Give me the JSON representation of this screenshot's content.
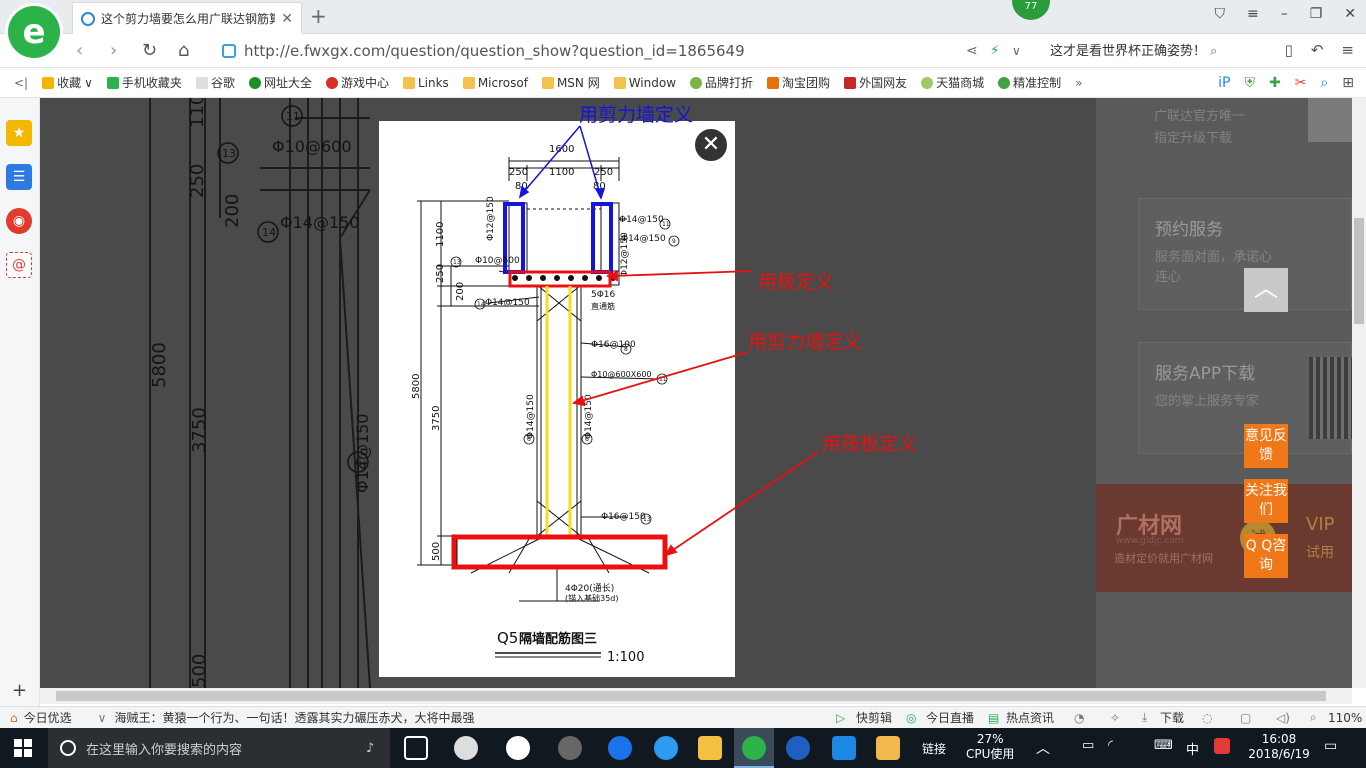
{
  "browser": {
    "tab_title": "这个剪力墙要怎么用广联达钢筋算",
    "badge": "77",
    "url": "http://e.fwxgx.com/question/question_show?question_id=1865649",
    "search_hint": "这才是看世界杯正确姿势！",
    "bookmarks": [
      "收藏",
      "手机收藏夹",
      "谷歌",
      "网址大全",
      "游戏中心",
      "Links",
      "Microsof",
      "MSN 网",
      "Window",
      "品牌打折",
      "淘宝团购",
      "外国网友",
      "天猫商城",
      "精准控制"
    ],
    "bookmark_colors": [
      "#f4b400",
      "#2bb34a",
      "#999999",
      "#1a8f2a",
      "#d93025",
      "#f2c14e",
      "#f2c14e",
      "#f2c14e",
      "#f2c14e",
      "#7cb342",
      "#e8710a",
      "#c62828",
      "#9ccc65",
      "#43a047"
    ]
  },
  "right_panel": {
    "top_text": [
      "广联达官方唯一",
      "指定升级下载"
    ],
    "cards": [
      {
        "title": "预约服务",
        "desc": "服务面对面，承诺心连心"
      },
      {
        "title": "服务APP下载",
        "desc": "您的掌上服务专家"
      }
    ],
    "float_buttons": [
      "意见反馈",
      "关注我们",
      "Q Q咨询"
    ],
    "ad": {
      "brand": "广材网",
      "sub": "造材定价就用广材网",
      "site": "www.gldjc.com",
      "trial": "试",
      "vip": "VIP",
      "trial2": "试用"
    }
  },
  "drawing": {
    "title_code": "Q5",
    "title_text": "隔墙配筋图三",
    "scale": "1:100",
    "dims_top": [
      "1600",
      "250",
      "1100",
      "250",
      "80",
      "80"
    ],
    "dims_left": [
      "1100",
      "250",
      "200",
      "3750",
      "500",
      "5800"
    ],
    "rebar_labels": [
      "Φ12@150",
      "Φ14@150",
      "Φ14@150",
      "Φ12@150",
      "Φ10@600",
      "Φ14@150",
      "5Φ16",
      "直通筋",
      "Φ16@100",
      "Φ10@600X600",
      "Φ14@150",
      "Φ14@150",
      "Φ16@150",
      "4Φ20(通长)",
      "(锚入基础35d)"
    ],
    "circle_labels": [
      "11",
      "9",
      "13",
      "14",
      "8",
      "11",
      "6",
      "6",
      "13"
    ],
    "annotations": {
      "shear_wall_top": "用剪力墙定义",
      "slab": "用板定义",
      "shear_wall_mid": "用剪力墙定义",
      "raft": "用筏板定义"
    },
    "colors": {
      "blue": "#1414dc",
      "red": "#e81010",
      "yellow": "#f0e020"
    }
  },
  "background_drawing": {
    "labels": [
      "110",
      "250",
      "200",
      "5800",
      "3750",
      "500",
      "Φ10@600",
      "Φ14@150",
      "Φ14@150"
    ],
    "circle_labels": [
      "11",
      "13",
      "14",
      "6"
    ]
  },
  "statusbar": {
    "left": "今日优选",
    "headline": "海贼王：黄猿一个行为、一句话！透露其实力碾压赤犬，大将中最强",
    "items": [
      "快剪辑",
      "今日直播",
      "热点资讯",
      "下载"
    ],
    "zoom": "110%"
  },
  "taskbar": {
    "search_placeholder": "在这里输入你要搜索的内容",
    "link_label": "链接",
    "cpu_pct": "27%",
    "cpu_label": "CPU使用",
    "ime": "中",
    "time": "16:08",
    "date": "2018/6/19"
  }
}
